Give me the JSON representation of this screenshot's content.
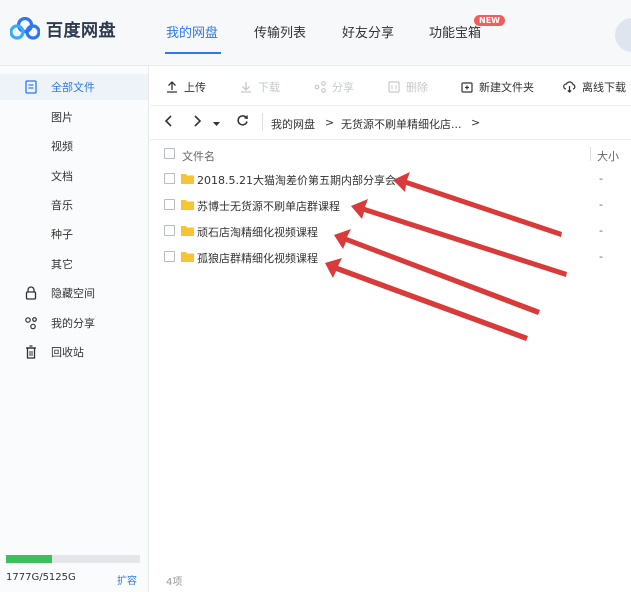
{
  "app": {
    "title": "百度网盘"
  },
  "nav": {
    "tabs": [
      {
        "label": "我的网盘",
        "active": true
      },
      {
        "label": "传输列表",
        "active": false
      },
      {
        "label": "好友分享",
        "active": false
      },
      {
        "label": "功能宝箱",
        "active": false
      }
    ],
    "badge": "NEW"
  },
  "sidebar": {
    "items": [
      {
        "label": "全部文件",
        "icon": "file-icon",
        "active": true
      },
      {
        "label": "图片"
      },
      {
        "label": "视频"
      },
      {
        "label": "文档"
      },
      {
        "label": "音乐"
      },
      {
        "label": "种子"
      },
      {
        "label": "其它"
      },
      {
        "label": "隐藏空间",
        "icon": "lock-icon"
      },
      {
        "label": "我的分享",
        "icon": "share-icon"
      },
      {
        "label": "回收站",
        "icon": "trash-icon"
      }
    ],
    "storage": {
      "used_fraction": 0.347,
      "text": "1777G/5125G",
      "expand_label": "扩容"
    }
  },
  "toolbar": {
    "upload": "上传",
    "download": "下载",
    "share": "分享",
    "delete": "删除",
    "new_folder": "新建文件夹",
    "offline_download": "离线下载"
  },
  "breadcrumb": {
    "root": "我的网盘",
    "separator": ">",
    "current": "无货源不刷单精细化店...",
    "trailing": ">"
  },
  "file_list": {
    "headers": {
      "name": "文件名",
      "size": "大小"
    },
    "rows": [
      {
        "name": "2018.5.21大猫淘差价第五期内部分享会",
        "size": "-"
      },
      {
        "name": "苏博士无货源不刷单店群课程",
        "size": "-"
      },
      {
        "name": "顽石店淘精细化视频课程",
        "size": "-"
      },
      {
        "name": "孤狼店群精细化视频课程",
        "size": "-"
      }
    ],
    "count_label": "4项"
  },
  "colors": {
    "accent": "#2f77f2",
    "storage_fill": "#3ebf5a",
    "folder": "#f7c531",
    "annotation_arrow": "#d93a3a",
    "badge": "#f45d5d"
  }
}
